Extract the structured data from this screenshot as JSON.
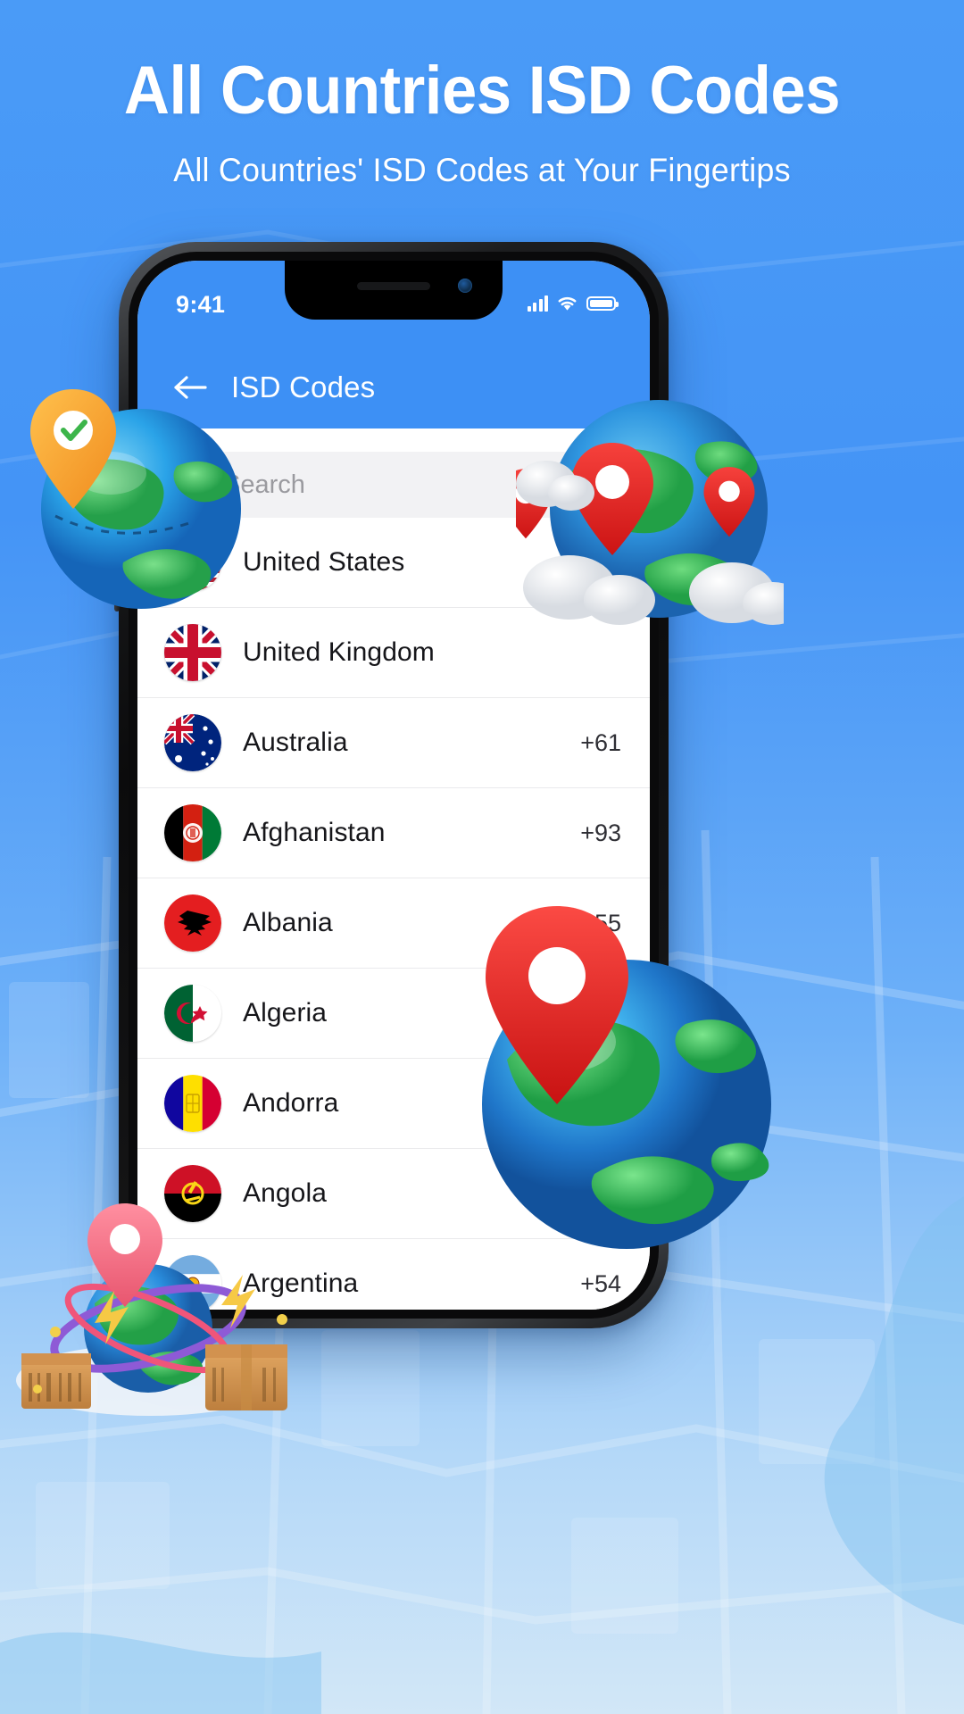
{
  "promo": {
    "title": "All Countries ISD Codes",
    "subtitle": "All Countries' ISD Codes at Your Fingertips",
    "background_color": "#4a9bf7",
    "accent_color": "#3d90f5"
  },
  "phone": {
    "status": {
      "time": "9:41",
      "signal_icon": "cellular-signal-icon",
      "wifi_icon": "wifi-icon",
      "battery_icon": "battery-full-icon"
    },
    "navbar": {
      "back_icon": "back-arrow-icon",
      "title": "ISD Codes"
    },
    "search": {
      "icon": "search-icon",
      "placeholder": "Search",
      "value": ""
    },
    "list": {
      "rows": [
        {
          "name": "United States",
          "code": "",
          "flag": "us"
        },
        {
          "name": "United Kingdom",
          "code": "",
          "flag": "gb"
        },
        {
          "name": "Australia",
          "code": "+61",
          "flag": "au"
        },
        {
          "name": "Afghanistan",
          "code": "+93",
          "flag": "af"
        },
        {
          "name": "Albania",
          "code": "+355",
          "flag": "al"
        },
        {
          "name": "Algeria",
          "code": "",
          "flag": "dz"
        },
        {
          "name": "Andorra",
          "code": "",
          "flag": "ad"
        },
        {
          "name": "Angola",
          "code": "",
          "flag": "ao"
        },
        {
          "name": "Argentina",
          "code": "+54",
          "flag": "ar"
        }
      ]
    }
  },
  "decorations": [
    {
      "name": "globe-with-location-pin-left",
      "icon": "globe-icon"
    },
    {
      "name": "globe-with-location-pins-right",
      "icon": "globe-icon"
    },
    {
      "name": "globe-with-location-pin-large",
      "icon": "globe-icon"
    },
    {
      "name": "globe-with-parcels",
      "icon": "package-icon"
    }
  ]
}
